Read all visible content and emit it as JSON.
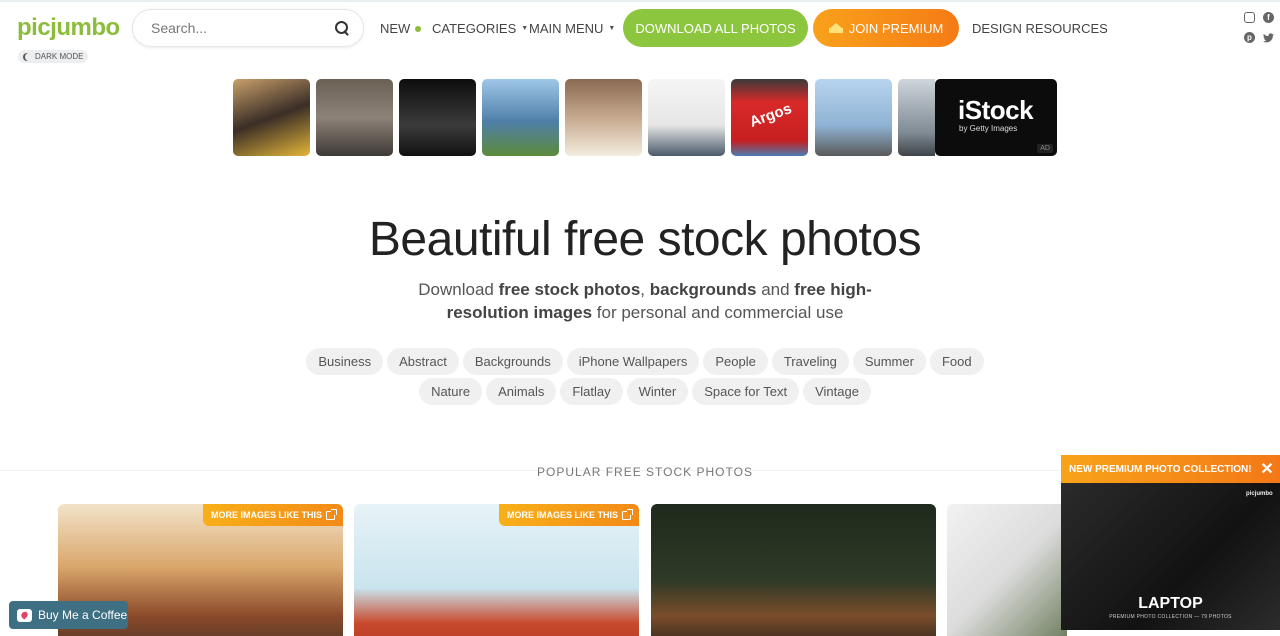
{
  "header": {
    "logo": "picjumbo",
    "dark_mode_label": "DARK MODE",
    "search_placeholder": "Search...",
    "nav": {
      "new": "NEW",
      "categories": "CATEGORIES",
      "main_menu": "MAIN MENU",
      "design_resources": "DESIGN RESOURCES"
    },
    "download_all": "DOWNLOAD ALL PHOTOS",
    "join_premium": "JOIN PREMIUM",
    "social_icons": [
      "instagram-icon",
      "facebook-icon",
      "pinterest-icon",
      "twitter-icon"
    ]
  },
  "ad_strip": {
    "thumbnails": [
      "taxi-woman",
      "city-street",
      "night-skyline",
      "glass-towers",
      "cheesecake",
      "white-living-room",
      "argos-sign",
      "street-signpost",
      "parked-car"
    ],
    "argos_text": "Argos",
    "istock": {
      "brand": "iStock",
      "byline": "by Getty Images",
      "ad_label": "AD"
    }
  },
  "hero": {
    "title": "Beautiful free stock photos",
    "sub_1": "Download ",
    "sub_b1": "free stock photos",
    "sub_2": ", ",
    "sub_b2": "backgrounds",
    "sub_3": " and ",
    "sub_b3": "free high-resolution images",
    "sub_4": " for personal and commercial use"
  },
  "tags_row1": [
    "Business",
    "Abstract",
    "Backgrounds",
    "iPhone Wallpapers",
    "People",
    "Traveling",
    "Summer",
    "Food"
  ],
  "tags_row2": [
    "Nature",
    "Animals",
    "Flatlay",
    "Winter",
    "Space for Text",
    "Vintage"
  ],
  "popular_title": "POPULAR FREE STOCK PHOTOS",
  "cards": {
    "more_label": "MORE IMAGES LIKE THIS"
  },
  "coffee_button": "Buy Me a Coffee",
  "promo": {
    "header": "NEW PREMIUM PHOTO COLLECTION!",
    "close": "✕",
    "logo": "picjumbo",
    "title": "LAPTOP",
    "caption": "PREMIUM PHOTO COLLECTION — 79 PHOTOS"
  },
  "colors": {
    "brand_green": "#8bbd3b",
    "premium_orange": "#f57b15",
    "coffee_blue": "#3f6f83"
  }
}
